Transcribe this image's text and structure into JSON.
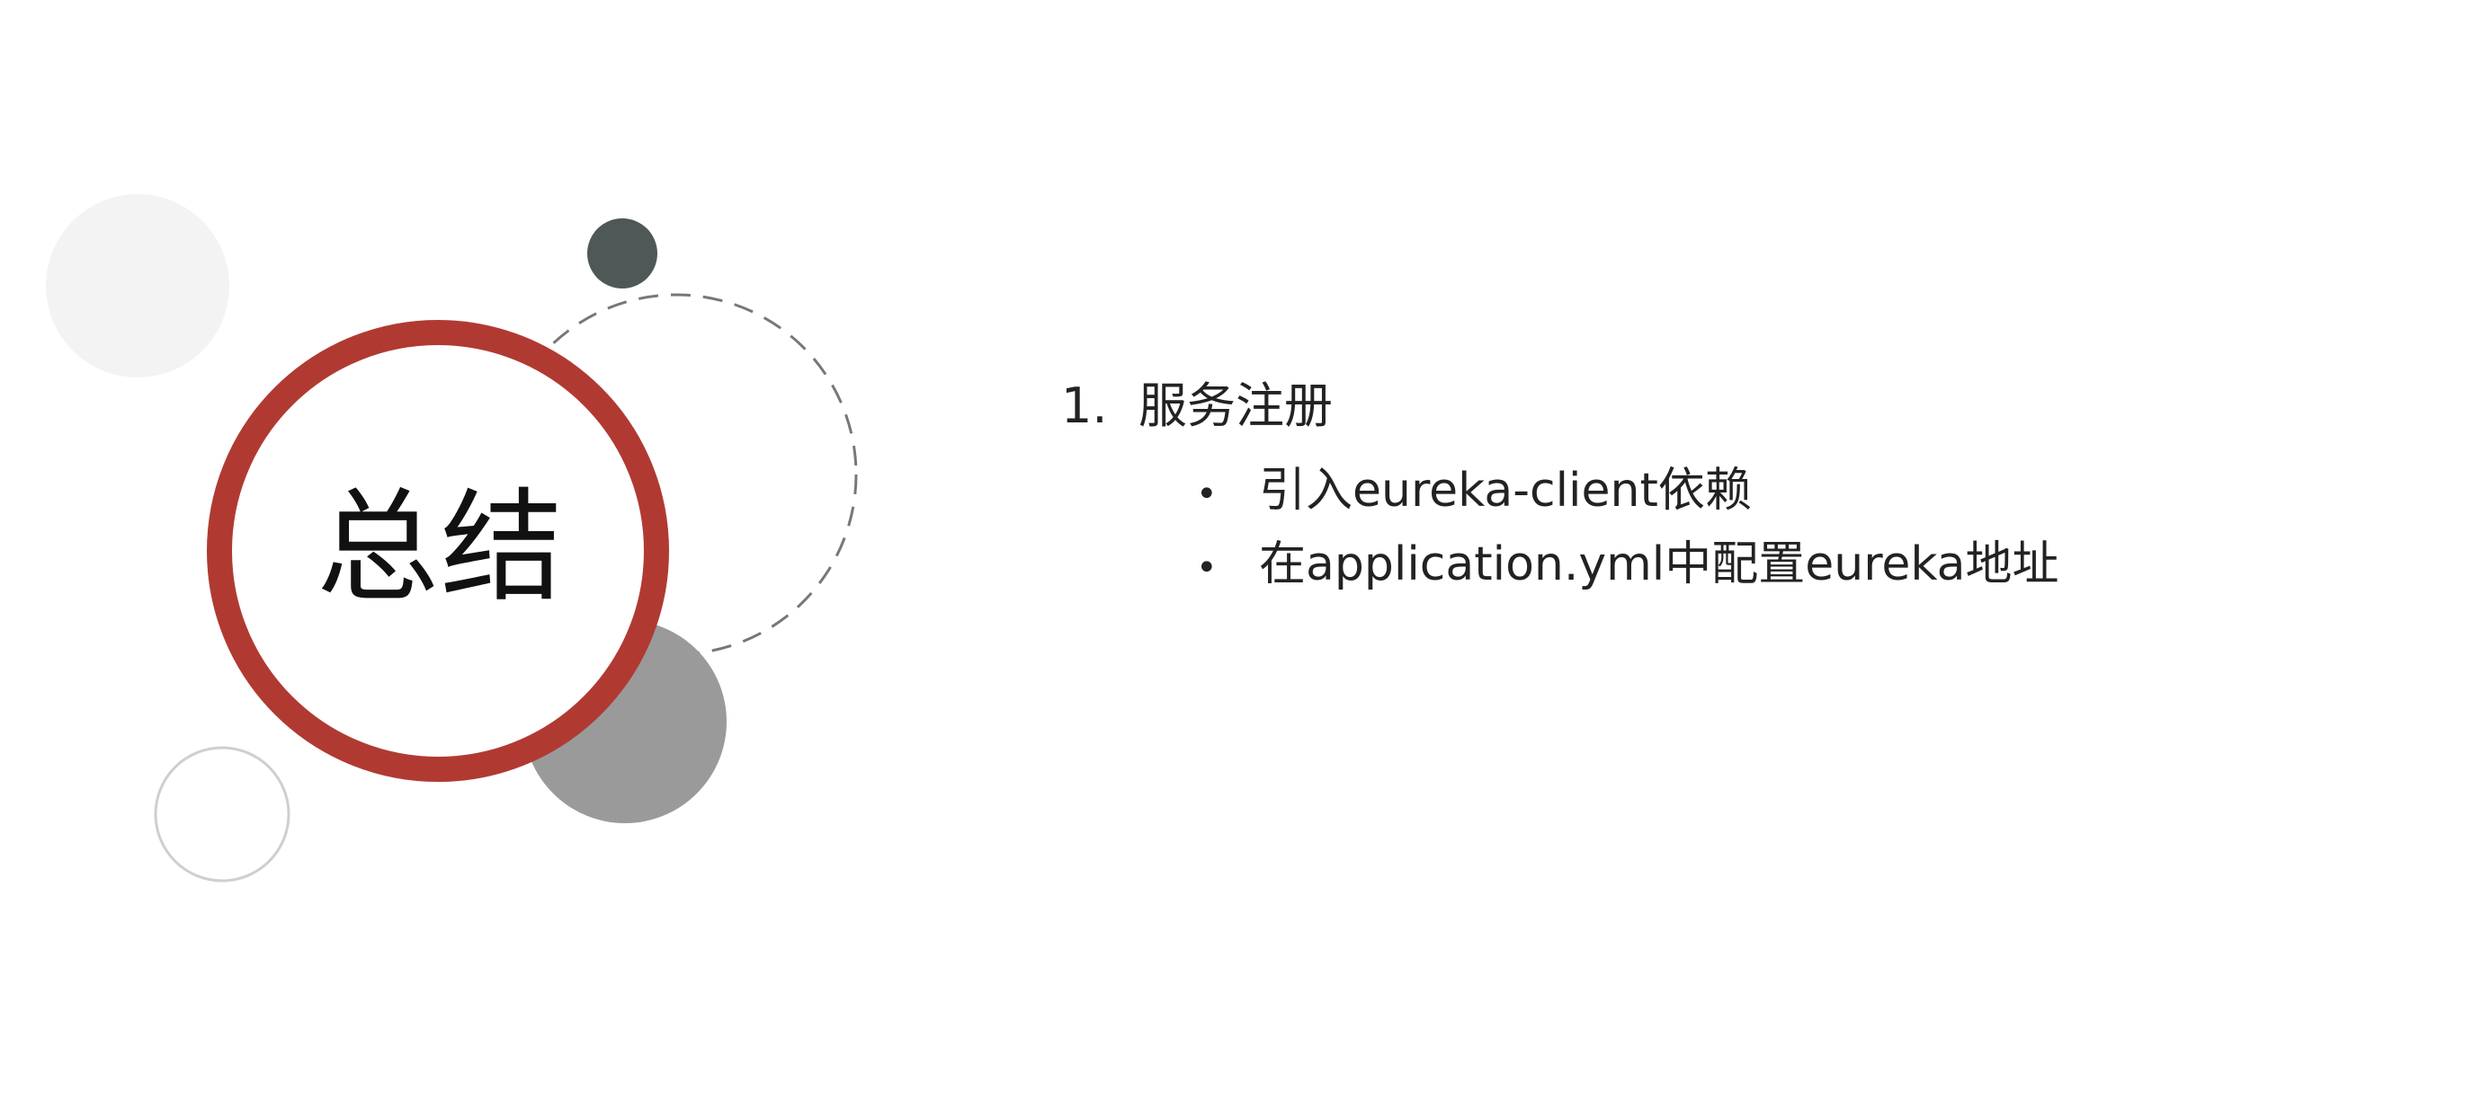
{
  "title": "总结",
  "colors": {
    "accent_red": "#b03a32",
    "dark_gray": "#505757",
    "mid_gray": "#9a9a9a",
    "light_gray": "#f3f3f3",
    "outline_gray": "#cfcfcf",
    "dashed_gray": "#777777"
  },
  "content": {
    "sections": [
      {
        "number": "1.",
        "heading": "服务注册",
        "bullets": [
          "引入eureka-client依赖",
          "在application.yml中配置eureka地址"
        ]
      }
    ]
  }
}
